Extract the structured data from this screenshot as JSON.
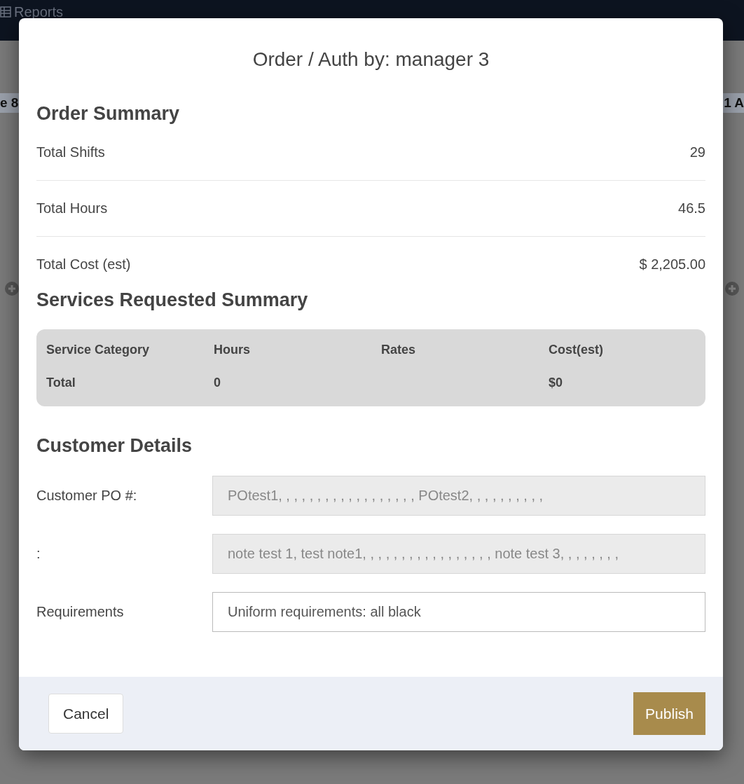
{
  "background": {
    "nav_item": "Reports",
    "left_fragment": "e 8",
    "right_fragment": "1 A"
  },
  "modal": {
    "title": "Order / Auth by: manager 3",
    "order_summary": {
      "heading": "Order Summary",
      "rows": [
        {
          "label": "Total Shifts",
          "value": "29",
          "currency": ""
        },
        {
          "label": "Total Hours",
          "value": "46.5",
          "currency": ""
        },
        {
          "label": "Total Cost (est)",
          "value": "2,205.00",
          "currency": "$"
        }
      ]
    },
    "services": {
      "heading": "Services Requested Summary",
      "columns": [
        "Service Category",
        "Hours",
        "Rates",
        "Cost(est)"
      ],
      "rows": [
        [
          "Total",
          "0",
          "",
          "$0"
        ]
      ]
    },
    "customer": {
      "heading": "Customer Details",
      "fields": [
        {
          "label": "Customer PO #:",
          "value": "POtest1, , , , , , , , , , , , , , , , , , POtest2, , , , , , , , , ,",
          "disabled": true
        },
        {
          "label": ":",
          "value": "note test 1, test note1, , , , , , , , , , , , , , , , , note test 3, , , , , , , ,",
          "disabled": true
        },
        {
          "label": "Requirements",
          "value": "Uniform requirements: all black",
          "disabled": false
        }
      ]
    },
    "buttons": [
      {
        "label": "Cancel",
        "kind": "secondary"
      },
      {
        "label": "Publish",
        "kind": "primary"
      }
    ]
  }
}
